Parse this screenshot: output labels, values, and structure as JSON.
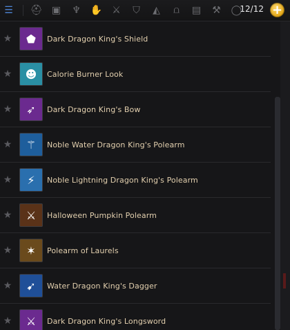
{
  "toolbar": {
    "icons": [
      "menu-icon",
      "helmet-icon",
      "armor-icon",
      "cape-icon",
      "glove-icon",
      "sword-icon",
      "shield-icon",
      "pouch-icon",
      "pants-icon",
      "belt-icon",
      "weapon-icon",
      "ring-icon"
    ],
    "slots_text": "12/12",
    "add_label": "+"
  },
  "items": [
    {
      "name": "Dark Dragon King's Shield",
      "color": "#6b2a8f"
    },
    {
      "name": "Calorie Burner Look",
      "color": "#2a8fa4"
    },
    {
      "name": "Dark Dragon King's Bow",
      "color": "#6b2a8f"
    },
    {
      "name": "Noble Water Dragon King's Polearm",
      "color": "#1e5e9c"
    },
    {
      "name": "Noble Lightning Dragon King's Polearm",
      "color": "#2a6fae"
    },
    {
      "name": "Halloween Pumpkin Polearm",
      "color": "#5a3218"
    },
    {
      "name": "Polearm of Laurels",
      "color": "#6a4a1c"
    },
    {
      "name": "Water Dragon King's Dagger",
      "color": "#1f4f98"
    },
    {
      "name": "Dark Dragon King's Longsword",
      "color": "#6b2a8f"
    }
  ]
}
